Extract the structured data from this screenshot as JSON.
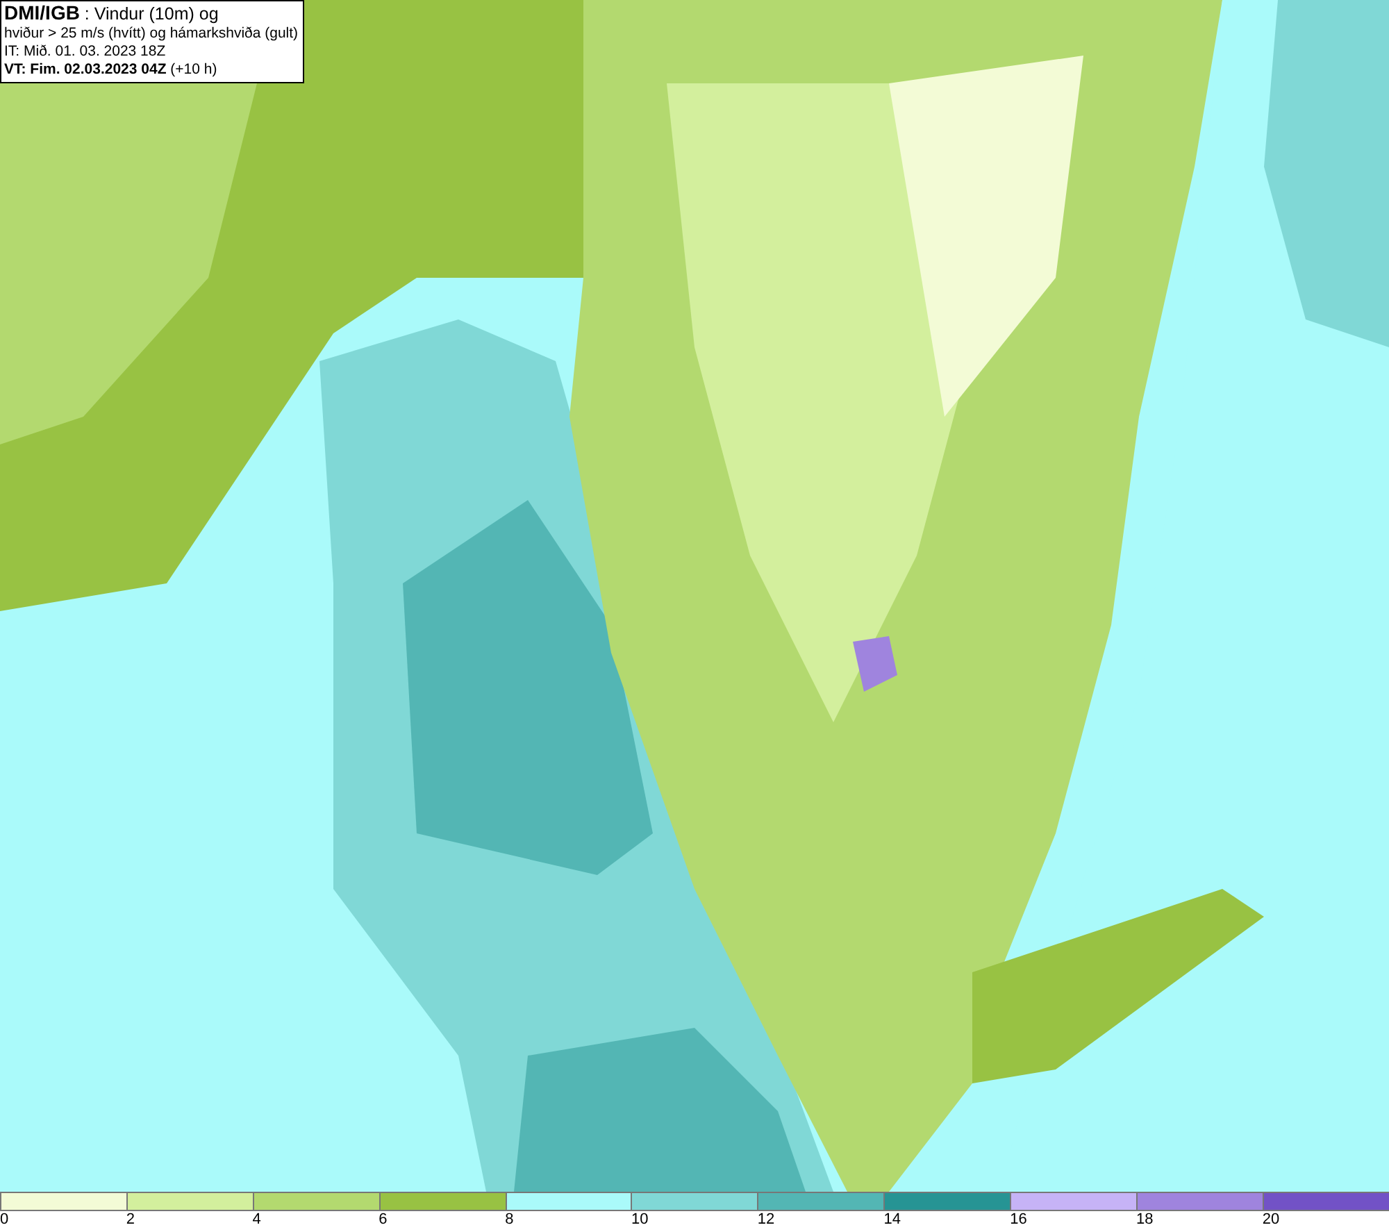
{
  "info_box": {
    "lines": [
      {
        "text": "**DMI/IGB** : Vindur (10m) og",
        "kind": "title"
      },
      {
        "text": "hviður > 25 m/s (hvítt) og hámarkshviða (gult)",
        "kind": "plain"
      },
      {
        "text": "IT: Mið. 01. 03. 2023 18Z",
        "kind": "plain"
      },
      {
        "text": "**VT: Fim. 02.03.2023 04Z** (+10 h)",
        "kind": "plain"
      }
    ]
  },
  "legend": {
    "bins": [
      {
        "label": "0",
        "color": "#f3fbd6"
      },
      {
        "label": "2",
        "color": "#d3ef9d"
      },
      {
        "label": "4",
        "color": "#b3d96f"
      },
      {
        "label": "6",
        "color": "#98c243"
      },
      {
        "label": "8",
        "color": "#aafafa"
      },
      {
        "label": "10",
        "color": "#80d8d6"
      },
      {
        "label": "12",
        "color": "#53b6b4"
      },
      {
        "label": "14",
        "color": "#269494"
      },
      {
        "label": "16",
        "color": "#c6b3f6"
      },
      {
        "label": "18",
        "color": "#9f84de"
      },
      {
        "label": "20",
        "color": "#7252c6"
      }
    ]
  }
}
